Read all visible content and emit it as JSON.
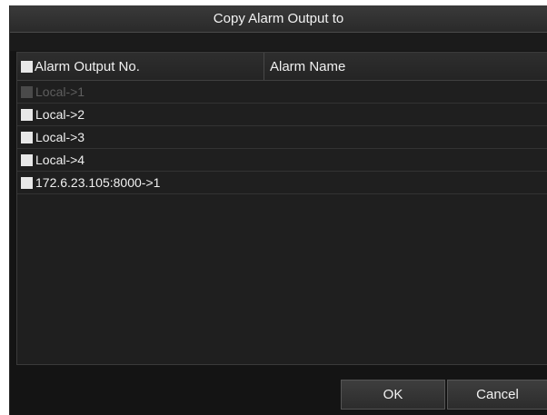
{
  "dialog": {
    "title": "Copy Alarm Output to"
  },
  "table": {
    "columns": [
      "Alarm Output No.",
      "Alarm Name"
    ],
    "rows": [
      {
        "output": "Local->1",
        "name": "",
        "disabled": true
      },
      {
        "output": "Local->2",
        "name": ""
      },
      {
        "output": "Local->3",
        "name": ""
      },
      {
        "output": "Local->4",
        "name": ""
      },
      {
        "output": "172.6.23.105:8000->1",
        "name": ""
      }
    ]
  },
  "buttons": {
    "ok": "OK",
    "cancel": "Cancel"
  }
}
